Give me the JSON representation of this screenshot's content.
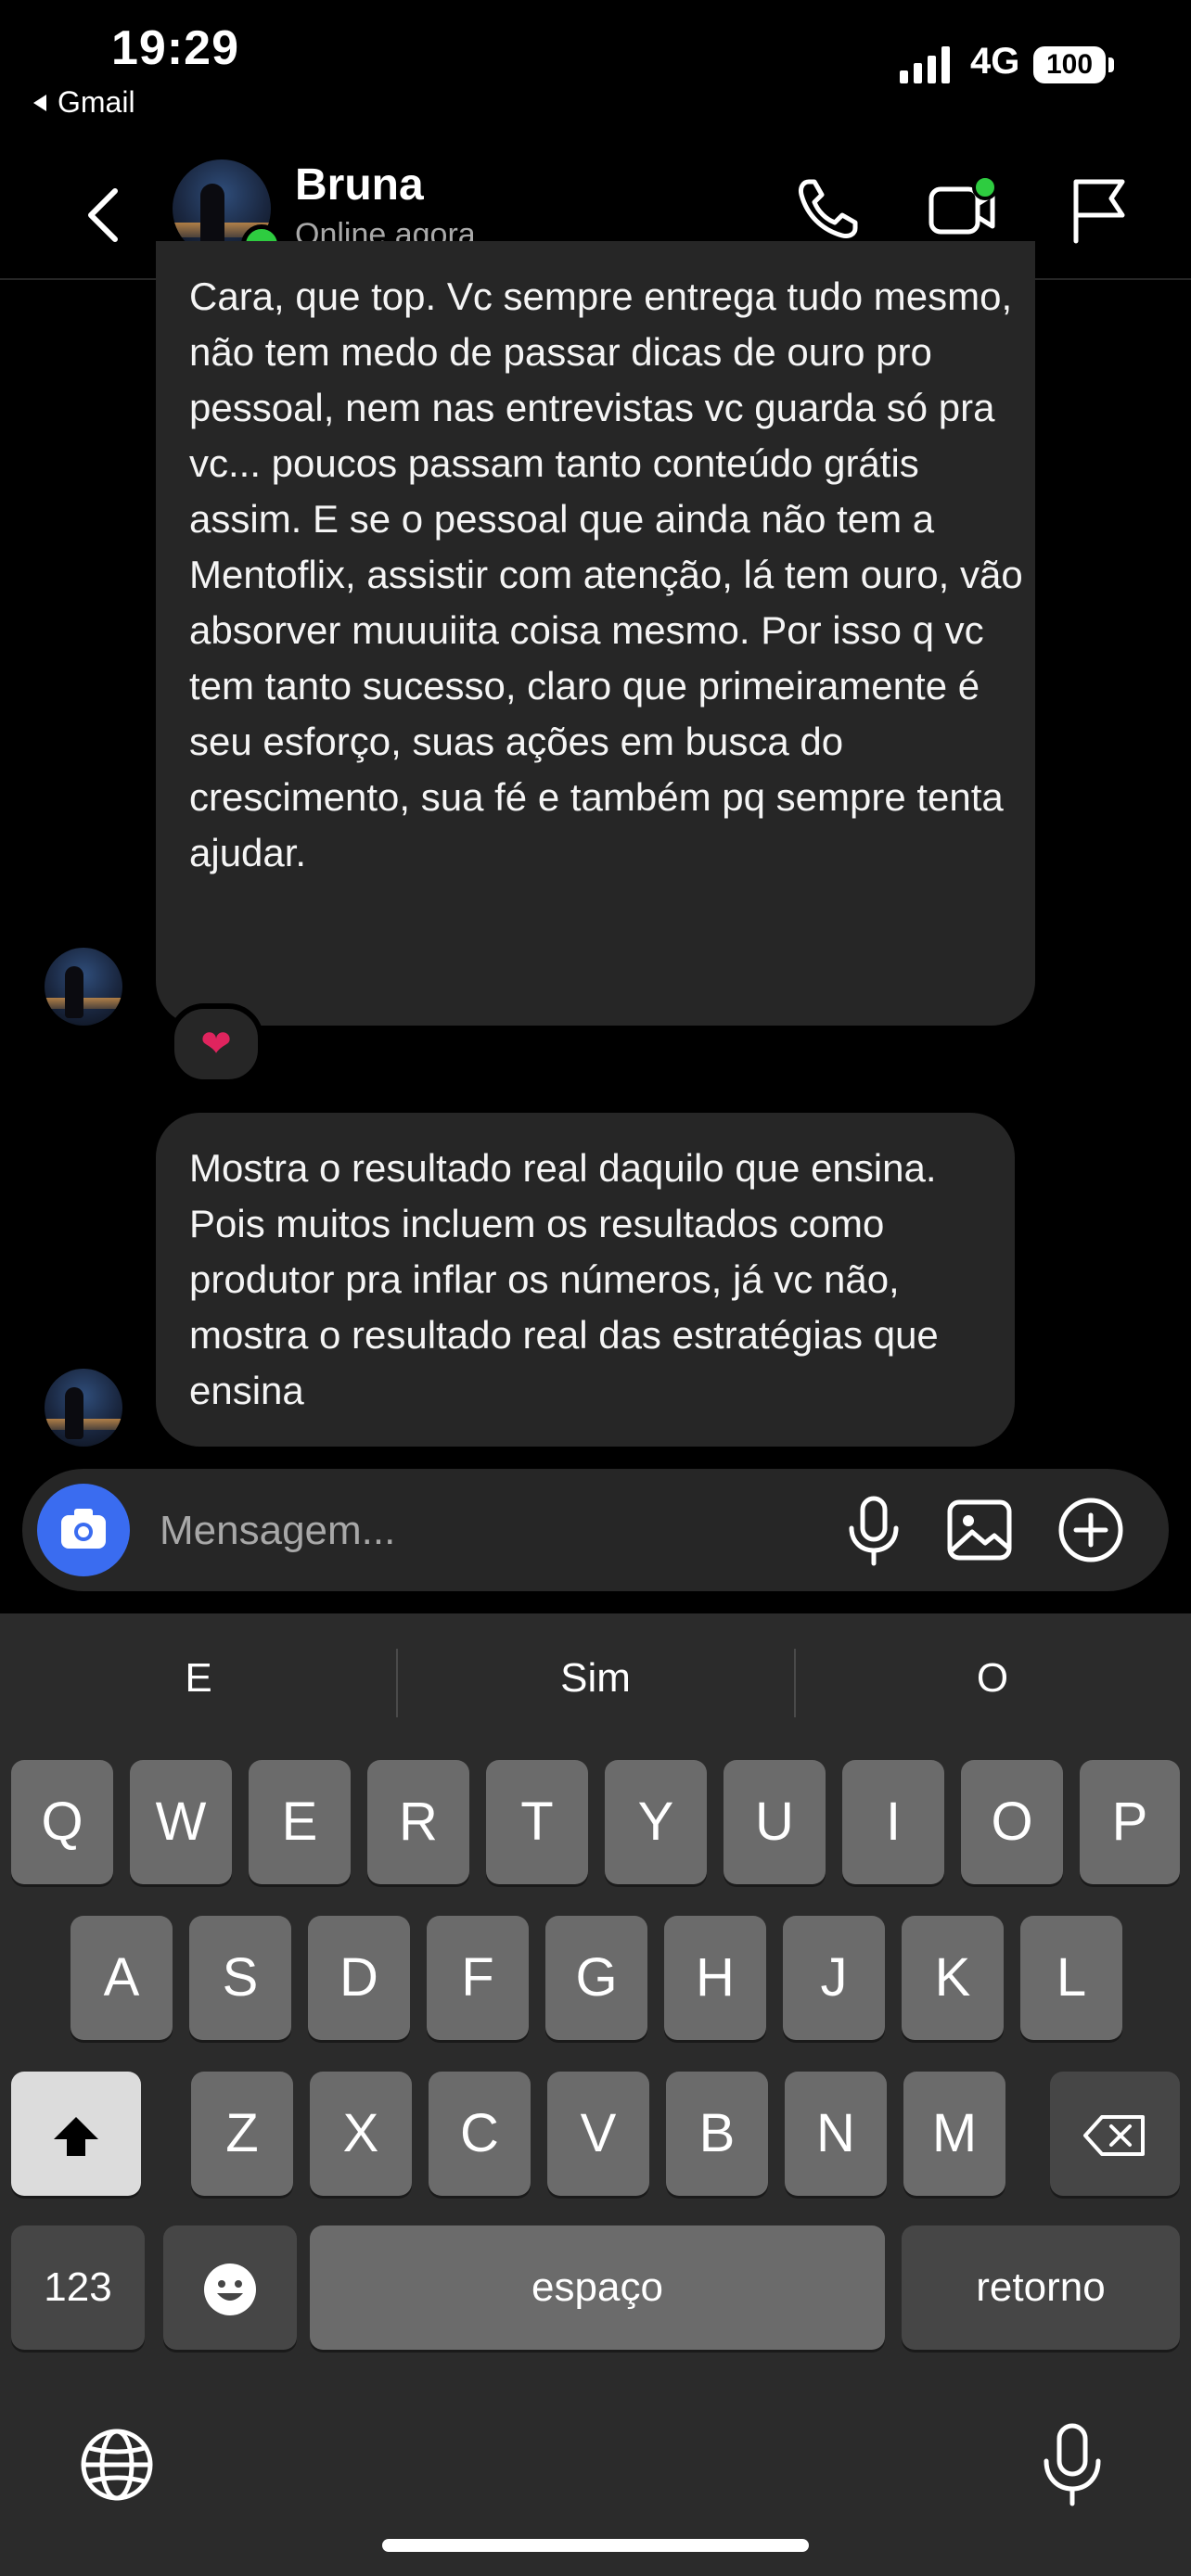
{
  "status_bar": {
    "time": "19:29",
    "back_app": "Gmail",
    "network": "4G",
    "battery": "100"
  },
  "header": {
    "contact_name": "Bruna",
    "presence": "Online agora"
  },
  "messages": [
    {
      "sender": "Bruna",
      "text": "Cara, que top. Vc sempre entrega tudo mesmo, não tem medo de passar dicas de ouro pro pessoal, nem nas entrevistas vc guarda só pra vc... poucos passam tanto conteúdo grátis assim. E se o pessoal que ainda não tem a Mentoflix, assistir com atenção, lá tem ouro, vão absorver muuuiita coisa mesmo. Por isso q vc tem tanto sucesso, claro que primeiramente é seu esforço, suas ações em busca do crescimento, sua fé e também pq sempre tenta ajudar.",
      "reaction": "❤"
    },
    {
      "sender": "Bruna",
      "text": "Mostra o resultado real daquilo que ensina. Pois muitos incluem os resultados como produtor pra inflar os números, já vc não, mostra o resultado real das estratégias que ensina"
    }
  ],
  "composer": {
    "placeholder": "Mensagem..."
  },
  "keyboard": {
    "suggestions": [
      "E",
      "Sim",
      "O"
    ],
    "row1": [
      "Q",
      "W",
      "E",
      "R",
      "T",
      "Y",
      "U",
      "I",
      "O",
      "P"
    ],
    "row2": [
      "A",
      "S",
      "D",
      "F",
      "G",
      "H",
      "J",
      "K",
      "L"
    ],
    "row3": [
      "Z",
      "X",
      "C",
      "V",
      "B",
      "N",
      "M"
    ],
    "numbers_key": "123",
    "space_key": "espaço",
    "return_key": "retorno"
  },
  "colors": {
    "online": "#2ecc40",
    "camera_button": "#3a6cf0",
    "bubble": "#262626"
  }
}
